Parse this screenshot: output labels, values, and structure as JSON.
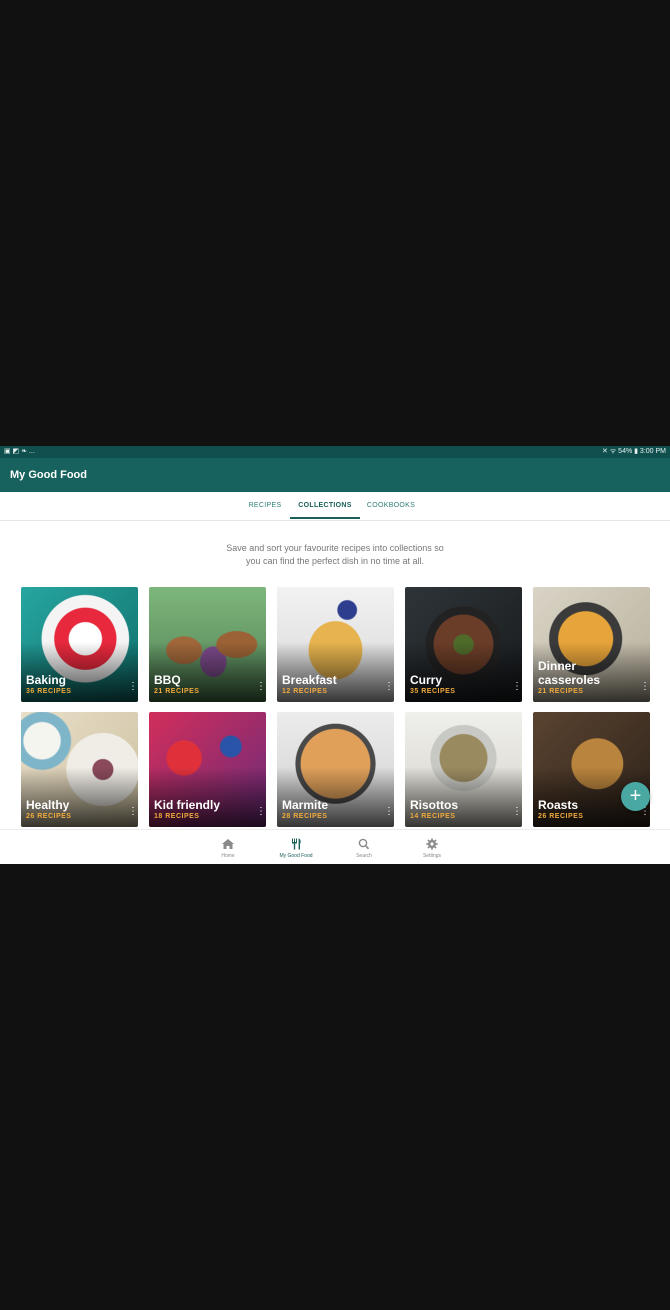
{
  "status_bar": {
    "left_icons": "▣ ◩ ❧ ...",
    "right_text": "✕ ᯤ 54% ▮ 3:00 PM"
  },
  "app": {
    "title": "My Good Food"
  },
  "tabs": [
    {
      "label": "RECIPES",
      "active": false
    },
    {
      "label": "COLLECTIONS",
      "active": true
    },
    {
      "label": "COOKBOOKS",
      "active": false
    }
  ],
  "intro": {
    "line1": "Save and sort your favourite recipes into collections so",
    "line2": "you can find the perfect dish in no time at all."
  },
  "collections": [
    {
      "name": "Baking",
      "count": "36 RECIPES"
    },
    {
      "name": "BBQ",
      "count": "21 RECIPES"
    },
    {
      "name": "Breakfast",
      "count": "12 RECIPES"
    },
    {
      "name": "Curry",
      "count": "35 RECIPES"
    },
    {
      "name": "Dinner casseroles",
      "count": "21 RECIPES"
    },
    {
      "name": "Healthy",
      "count": "26 RECIPES"
    },
    {
      "name": "Kid friendly",
      "count": "18 RECIPES"
    },
    {
      "name": "Marmite",
      "count": "28 RECIPES"
    },
    {
      "name": "Risottos",
      "count": "14 RECIPES"
    },
    {
      "name": "Roasts",
      "count": "26 RECIPES"
    }
  ],
  "fab": {
    "icon": "plus-icon",
    "symbol": "+"
  },
  "bottom_nav": [
    {
      "label": "Home",
      "icon": "home-icon",
      "active": false
    },
    {
      "label": "My Good Food",
      "icon": "cutlery-icon",
      "active": true
    },
    {
      "label": "Search",
      "icon": "search-icon",
      "active": false
    },
    {
      "label": "Settings",
      "icon": "gear-icon",
      "active": false
    }
  ],
  "colors": {
    "appbar": "#17625e",
    "statusbar": "#0f4f4d",
    "accent": "#1a5f5a",
    "recipe_count": "#f0a93b",
    "fab": "#4aa8a3"
  }
}
